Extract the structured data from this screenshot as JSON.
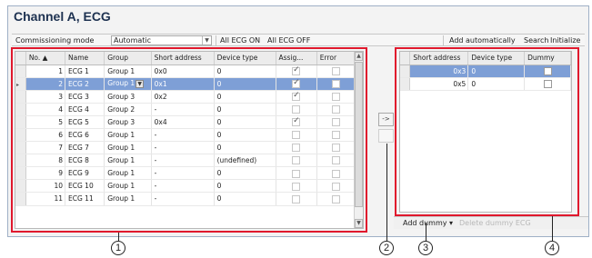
{
  "window": {
    "title": "Channel A, ECG"
  },
  "toolbar": {
    "commissioning_label": "Commissioning mode",
    "commissioning_value": "Automatic",
    "all_ecg_on": "All ECG ON",
    "all_ecg_off": "All ECG OFF",
    "add_automatically": "Add automatically",
    "search": "Search",
    "initialize": "Initialize"
  },
  "ecg_table": {
    "columns": [
      "No.",
      "Name",
      "Group",
      "Short address",
      "Device type",
      "Assig...",
      "Error"
    ],
    "rows": [
      {
        "no": "1",
        "name": "ECG 1",
        "group": "Group 1",
        "short": "0x0",
        "device": "0",
        "assigned": true,
        "error": false
      },
      {
        "no": "2",
        "name": "ECG 2",
        "group": "Group 1",
        "short": "0x1",
        "device": "0",
        "assigned": true,
        "error": false,
        "selected": true
      },
      {
        "no": "3",
        "name": "ECG 3",
        "group": "Group 3",
        "short": "0x2",
        "device": "0",
        "assigned": true,
        "error": false
      },
      {
        "no": "4",
        "name": "ECG 4",
        "group": "Group 2",
        "short": "-",
        "device": "0",
        "assigned": false,
        "error": false
      },
      {
        "no": "5",
        "name": "ECG 5",
        "group": "Group 3",
        "short": "0x4",
        "device": "0",
        "assigned": true,
        "error": false
      },
      {
        "no": "6",
        "name": "ECG 6",
        "group": "Group 1",
        "short": "-",
        "device": "0",
        "assigned": false,
        "error": false
      },
      {
        "no": "7",
        "name": "ECG 7",
        "group": "Group 1",
        "short": "-",
        "device": "0",
        "assigned": false,
        "error": false
      },
      {
        "no": "8",
        "name": "ECG 8",
        "group": "Group 1",
        "short": "-",
        "device": "(undefined)",
        "assigned": false,
        "error": false
      },
      {
        "no": "9",
        "name": "ECG 9",
        "group": "Group 1",
        "short": "-",
        "device": "0",
        "assigned": false,
        "error": false
      },
      {
        "no": "10",
        "name": "ECG 10",
        "group": "Group 1",
        "short": "-",
        "device": "0",
        "assigned": false,
        "error": false
      },
      {
        "no": "11",
        "name": "ECG 11",
        "group": "Group 1",
        "short": "-",
        "device": "0",
        "assigned": false,
        "error": false
      }
    ]
  },
  "move_buttons": {
    "move_right": "->",
    "move_left": "<-"
  },
  "short_table": {
    "columns": [
      "Short address",
      "Device type",
      "Dummy"
    ],
    "rows": [
      {
        "short": "0x3",
        "device": "0",
        "dummy": false,
        "selected": true
      },
      {
        "short": "0x5",
        "device": "0",
        "dummy": false
      }
    ]
  },
  "bottom": {
    "add_dummy": "Add dummy",
    "delete_dummy": "Delete dummy ECG"
  },
  "callouts": [
    "1",
    "2",
    "3",
    "4"
  ],
  "colors": {
    "highlight": "#e0182d",
    "selection": "#7e9fd6",
    "title": "#1d3150"
  }
}
